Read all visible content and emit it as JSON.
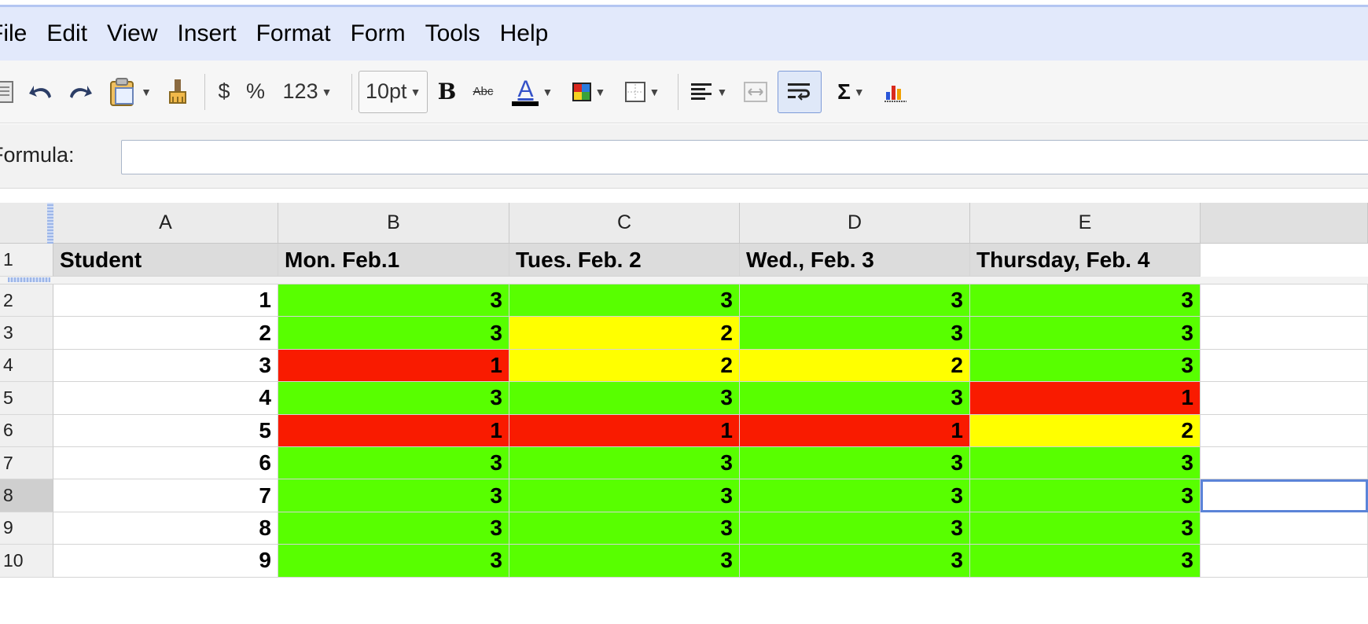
{
  "colors": {
    "green": "#58ff00",
    "yellow": "#ffff00",
    "red": "#f91b00",
    "menu_bg": "#e2e9fb",
    "selection": "#5b84d8"
  },
  "menu": [
    "File",
    "Edit",
    "View",
    "Insert",
    "Format",
    "Form",
    "Tools",
    "Help"
  ],
  "toolbar": {
    "currency": "$",
    "percent": "%",
    "number_format": "123",
    "font_size": "10pt",
    "bold": "B",
    "strike": "Abc",
    "text_color": "A",
    "sum": "Σ",
    "icons": [
      "print-icon",
      "undo-icon",
      "redo-icon",
      "paste-icon",
      "paint-format-icon",
      "bold-icon",
      "strikethrough-icon",
      "text-color-icon",
      "fill-color-icon",
      "borders-icon",
      "align-icon",
      "merge-icon",
      "wrap-text-icon",
      "sum-icon",
      "chart-icon"
    ]
  },
  "formula": {
    "label": "Formula:",
    "value": ""
  },
  "grid": {
    "columns": [
      "A",
      "B",
      "C",
      "D",
      "E"
    ],
    "row_numbers": [
      "1",
      "2",
      "3",
      "4",
      "5",
      "6",
      "7",
      "8",
      "9",
      "10"
    ],
    "headers": [
      "Student",
      "Mon. Feb.1",
      "Tues. Feb. 2",
      "Wed., Feb. 3",
      "Thursday, Feb. 4"
    ],
    "rows": [
      {
        "student": "1",
        "scores": [
          "3",
          "3",
          "3",
          "3"
        ]
      },
      {
        "student": "2",
        "scores": [
          "3",
          "2",
          "3",
          "3"
        ]
      },
      {
        "student": "3",
        "scores": [
          "1",
          "2",
          "2",
          "3"
        ]
      },
      {
        "student": "4",
        "scores": [
          "3",
          "3",
          "3",
          "1"
        ]
      },
      {
        "student": "5",
        "scores": [
          "1",
          "1",
          "1",
          "2"
        ]
      },
      {
        "student": "6",
        "scores": [
          "3",
          "3",
          "3",
          "3"
        ]
      },
      {
        "student": "7",
        "scores": [
          "3",
          "3",
          "3",
          "3"
        ]
      },
      {
        "student": "8",
        "scores": [
          "3",
          "3",
          "3",
          "3"
        ]
      },
      {
        "student": "9",
        "scores": [
          "3",
          "3",
          "3",
          "3"
        ]
      }
    ],
    "selected_row": "8",
    "selected_column": "F"
  }
}
